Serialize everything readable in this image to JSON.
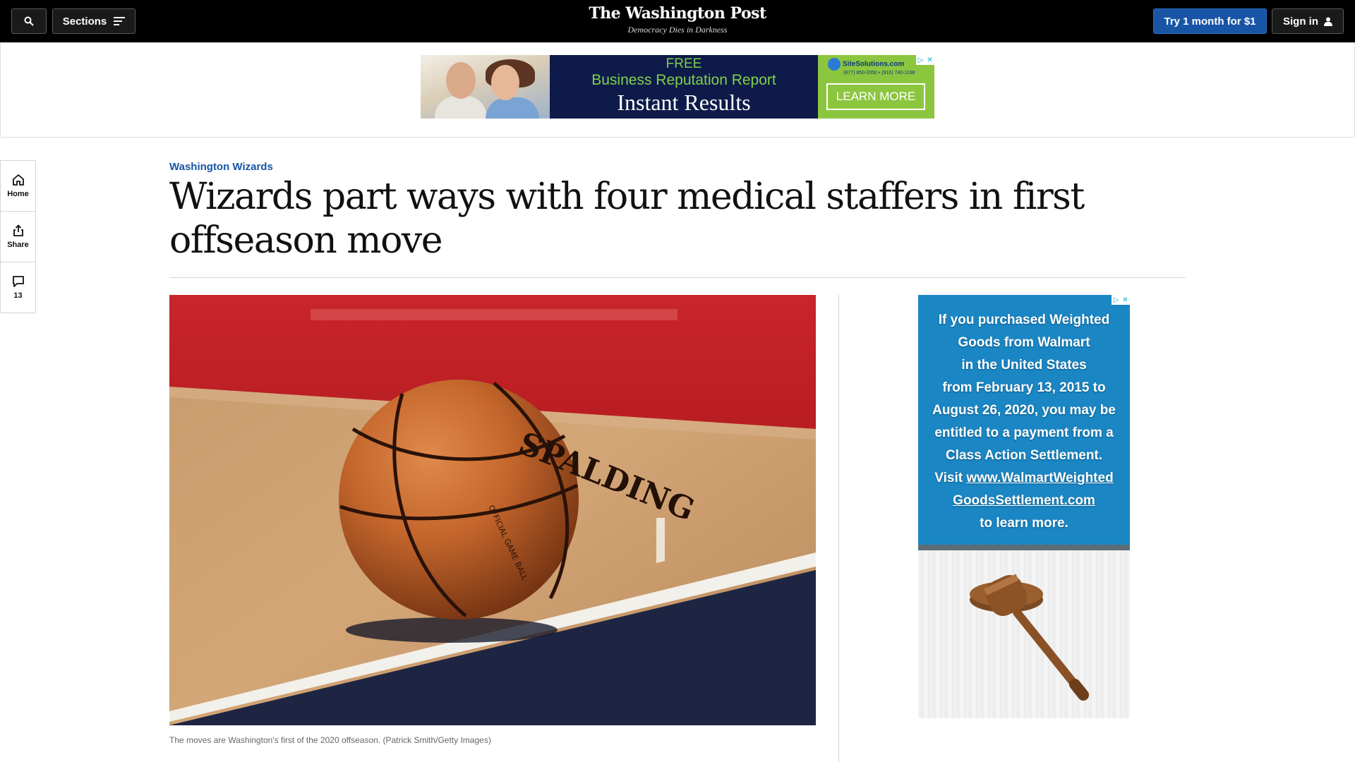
{
  "header": {
    "sections_label": "Sections",
    "brand_name": "The Washington Post",
    "tagline": "Democracy Dies in Darkness",
    "subscribe_label": "Try 1 month for $1",
    "signin_label": "Sign in"
  },
  "top_ad": {
    "line1": "FREE",
    "line2": "Business Reputation Report",
    "line3": "Instant Results",
    "cta": "LEARN MORE",
    "brand": "SiteSolutions.com",
    "phone": "(877) 850-2050 • (916) 740-1198"
  },
  "rail": {
    "home_label": "Home",
    "share_label": "Share",
    "comments_count": "13"
  },
  "article": {
    "kicker": "Washington Wizards",
    "headline": "Wizards part ways with four medical staffers in first offseason move",
    "caption": "The moves are Washington's first of the 2020 offseason. (Patrick Smith/Getty Images)"
  },
  "side_ad": {
    "lines": [
      "If you purchased Weighted",
      "Goods from Walmart",
      "in the United States",
      "from February 13, 2015 to",
      "August 26, 2020, you may be",
      "entitled to a payment from a",
      "Class Action Settlement."
    ],
    "visit_prefix": "Visit ",
    "url_part1": "www.WalmartWeighted",
    "url_part2": "GoodsSettlement.com",
    "closing": "to learn more."
  },
  "ball_text": {
    "brand": "SPALDING",
    "label": "OFFICIAL GAME BALL"
  },
  "colors": {
    "accent_blue": "#1955a5",
    "topbar": "#000000",
    "side_ad_blue": "#1a86c4"
  }
}
